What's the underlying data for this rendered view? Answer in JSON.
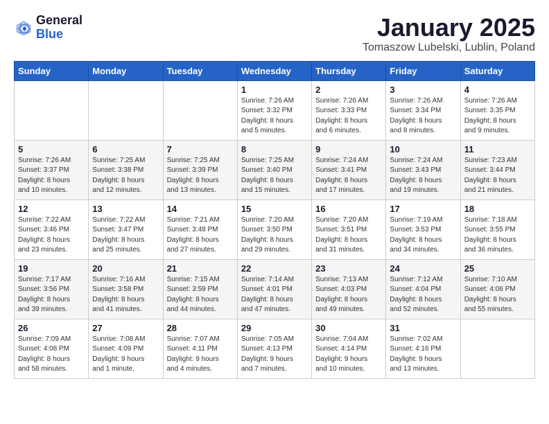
{
  "header": {
    "logo_general": "General",
    "logo_blue": "Blue",
    "title": "January 2025",
    "subtitle": "Tomaszow Lubelski, Lublin, Poland"
  },
  "weekdays": [
    "Sunday",
    "Monday",
    "Tuesday",
    "Wednesday",
    "Thursday",
    "Friday",
    "Saturday"
  ],
  "weeks": [
    [
      {
        "day": "",
        "info": ""
      },
      {
        "day": "",
        "info": ""
      },
      {
        "day": "",
        "info": ""
      },
      {
        "day": "1",
        "info": "Sunrise: 7:26 AM\nSunset: 3:32 PM\nDaylight: 8 hours\nand 5 minutes."
      },
      {
        "day": "2",
        "info": "Sunrise: 7:26 AM\nSunset: 3:33 PM\nDaylight: 8 hours\nand 6 minutes."
      },
      {
        "day": "3",
        "info": "Sunrise: 7:26 AM\nSunset: 3:34 PM\nDaylight: 8 hours\nand 8 minutes."
      },
      {
        "day": "4",
        "info": "Sunrise: 7:26 AM\nSunset: 3:35 PM\nDaylight: 8 hours\nand 9 minutes."
      }
    ],
    [
      {
        "day": "5",
        "info": "Sunrise: 7:26 AM\nSunset: 3:37 PM\nDaylight: 8 hours\nand 10 minutes."
      },
      {
        "day": "6",
        "info": "Sunrise: 7:25 AM\nSunset: 3:38 PM\nDaylight: 8 hours\nand 12 minutes."
      },
      {
        "day": "7",
        "info": "Sunrise: 7:25 AM\nSunset: 3:39 PM\nDaylight: 8 hours\nand 13 minutes."
      },
      {
        "day": "8",
        "info": "Sunrise: 7:25 AM\nSunset: 3:40 PM\nDaylight: 8 hours\nand 15 minutes."
      },
      {
        "day": "9",
        "info": "Sunrise: 7:24 AM\nSunset: 3:41 PM\nDaylight: 8 hours\nand 17 minutes."
      },
      {
        "day": "10",
        "info": "Sunrise: 7:24 AM\nSunset: 3:43 PM\nDaylight: 8 hours\nand 19 minutes."
      },
      {
        "day": "11",
        "info": "Sunrise: 7:23 AM\nSunset: 3:44 PM\nDaylight: 8 hours\nand 21 minutes."
      }
    ],
    [
      {
        "day": "12",
        "info": "Sunrise: 7:22 AM\nSunset: 3:46 PM\nDaylight: 8 hours\nand 23 minutes."
      },
      {
        "day": "13",
        "info": "Sunrise: 7:22 AM\nSunset: 3:47 PM\nDaylight: 8 hours\nand 25 minutes."
      },
      {
        "day": "14",
        "info": "Sunrise: 7:21 AM\nSunset: 3:48 PM\nDaylight: 8 hours\nand 27 minutes."
      },
      {
        "day": "15",
        "info": "Sunrise: 7:20 AM\nSunset: 3:50 PM\nDaylight: 8 hours\nand 29 minutes."
      },
      {
        "day": "16",
        "info": "Sunrise: 7:20 AM\nSunset: 3:51 PM\nDaylight: 8 hours\nand 31 minutes."
      },
      {
        "day": "17",
        "info": "Sunrise: 7:19 AM\nSunset: 3:53 PM\nDaylight: 8 hours\nand 34 minutes."
      },
      {
        "day": "18",
        "info": "Sunrise: 7:18 AM\nSunset: 3:55 PM\nDaylight: 8 hours\nand 36 minutes."
      }
    ],
    [
      {
        "day": "19",
        "info": "Sunrise: 7:17 AM\nSunset: 3:56 PM\nDaylight: 8 hours\nand 39 minutes."
      },
      {
        "day": "20",
        "info": "Sunrise: 7:16 AM\nSunset: 3:58 PM\nDaylight: 8 hours\nand 41 minutes."
      },
      {
        "day": "21",
        "info": "Sunrise: 7:15 AM\nSunset: 3:59 PM\nDaylight: 8 hours\nand 44 minutes."
      },
      {
        "day": "22",
        "info": "Sunrise: 7:14 AM\nSunset: 4:01 PM\nDaylight: 8 hours\nand 47 minutes."
      },
      {
        "day": "23",
        "info": "Sunrise: 7:13 AM\nSunset: 4:03 PM\nDaylight: 8 hours\nand 49 minutes."
      },
      {
        "day": "24",
        "info": "Sunrise: 7:12 AM\nSunset: 4:04 PM\nDaylight: 8 hours\nand 52 minutes."
      },
      {
        "day": "25",
        "info": "Sunrise: 7:10 AM\nSunset: 4:06 PM\nDaylight: 8 hours\nand 55 minutes."
      }
    ],
    [
      {
        "day": "26",
        "info": "Sunrise: 7:09 AM\nSunset: 4:08 PM\nDaylight: 8 hours\nand 58 minutes."
      },
      {
        "day": "27",
        "info": "Sunrise: 7:08 AM\nSunset: 4:09 PM\nDaylight: 9 hours\nand 1 minute."
      },
      {
        "day": "28",
        "info": "Sunrise: 7:07 AM\nSunset: 4:11 PM\nDaylight: 9 hours\nand 4 minutes."
      },
      {
        "day": "29",
        "info": "Sunrise: 7:05 AM\nSunset: 4:13 PM\nDaylight: 9 hours\nand 7 minutes."
      },
      {
        "day": "30",
        "info": "Sunrise: 7:04 AM\nSunset: 4:14 PM\nDaylight: 9 hours\nand 10 minutes."
      },
      {
        "day": "31",
        "info": "Sunrise: 7:02 AM\nSunset: 4:16 PM\nDaylight: 9 hours\nand 13 minutes."
      },
      {
        "day": "",
        "info": ""
      }
    ]
  ]
}
